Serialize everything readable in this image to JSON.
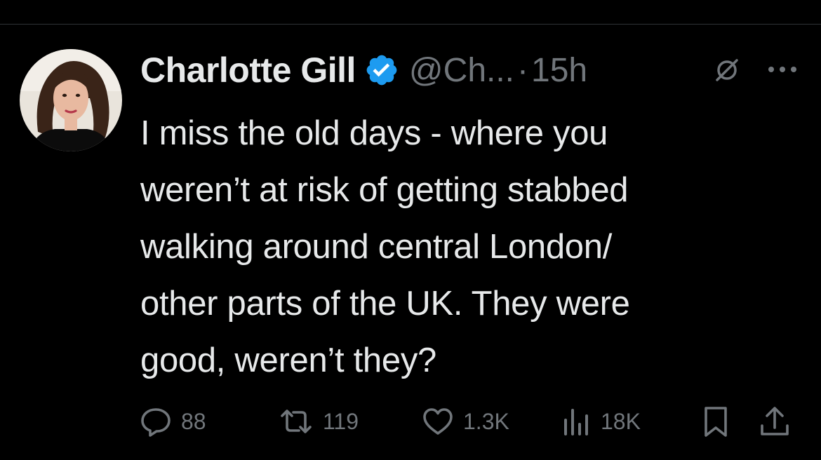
{
  "tweet": {
    "author": {
      "name": "Charlotte Gill",
      "handle": "@Ch...",
      "verified": true
    },
    "separator": "·",
    "time": "15h",
    "text": "I miss the old days - where you\nweren’t at risk of getting stabbed\nwalking around central London/\nother parts of the UK. They were\ngood, weren’t they?",
    "actions": {
      "replies": "88",
      "retweets": "119",
      "likes": "1.3K",
      "views": "18K"
    }
  },
  "colors": {
    "background": "#000000",
    "text_primary": "#e7e9ea",
    "text_secondary": "#71767b",
    "verified_blue": "#1d9bf0"
  },
  "icons": {
    "verified": "verified-badge-icon",
    "edit": "edited-icon",
    "more": "more-options-icon",
    "reply": "reply-icon",
    "retweet": "retweet-icon",
    "like": "heart-icon",
    "views": "views-chart-icon",
    "bookmark": "bookmark-icon",
    "share": "share-icon"
  }
}
